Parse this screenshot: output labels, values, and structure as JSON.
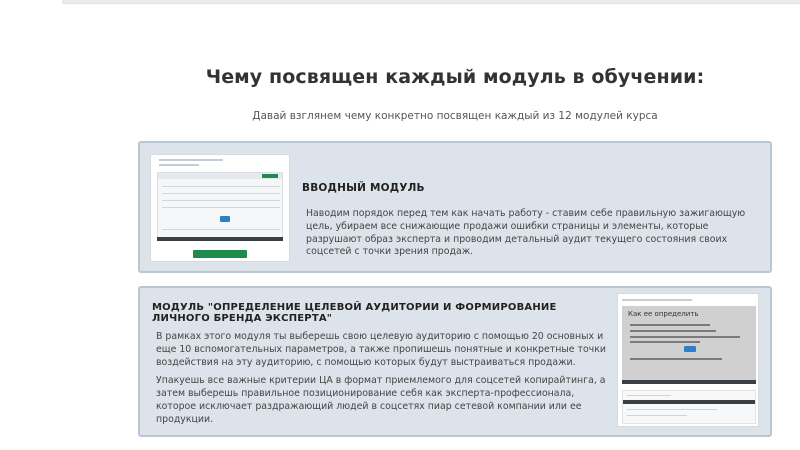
{
  "section": {
    "heading": "Чему посвящен каждый модуль в обучении:",
    "subheading": "Давай взглянем чему конкретно посвящен каждый из 12 модулей курса"
  },
  "modules": [
    {
      "title": "ВВОДНЫЙ МОДУЛЬ",
      "paragraphs": [
        "Наводим порядок перед тем как начать работу - ставим себе правильную  зажигающую цель, убираем все снижающие продажи ошибки страницы и элементы, которые разрушают образ эксперта и проводим детальный аудит текущего состояния своих соцсетей с точки зрения продаж."
      ]
    },
    {
      "title": "МОДУЛЬ \"ОПРЕДЕЛЕНИЕ ЦЕЛЕВОЙ АУДИТОРИИ И ФОРМИРОВАНИЕ ЛИЧНОГО БРЕНДА ЭКСПЕРТА\"",
      "paragraphs": [
        "В рамках этого модуля ты выберешь свою целевую аудиторию с помощью  20 основных и еще 10 вспомогательных параметров, а также пропишешь понятные и конкретные точки воздействия на эту аудиторию, с помощью которых будут выстраиваться продажи.",
        "Упакуешь все важные критерии ЦА в формат приемлемого для  соцсетей копирайтинга, а затем выберешь правильное позиционирование себя как эксперта-профессионала, которое исключает раздражающий людей в соцсетях пиар сетевой компании или ее продукции."
      ],
      "thumbnail_slide_heading": "Как ее определить"
    }
  ],
  "colors": {
    "card_bg": "#dde3ea",
    "card_border": "#b9c6d4",
    "accent_green": "#1f8b4c",
    "accent_blue": "#2f7fc8"
  }
}
